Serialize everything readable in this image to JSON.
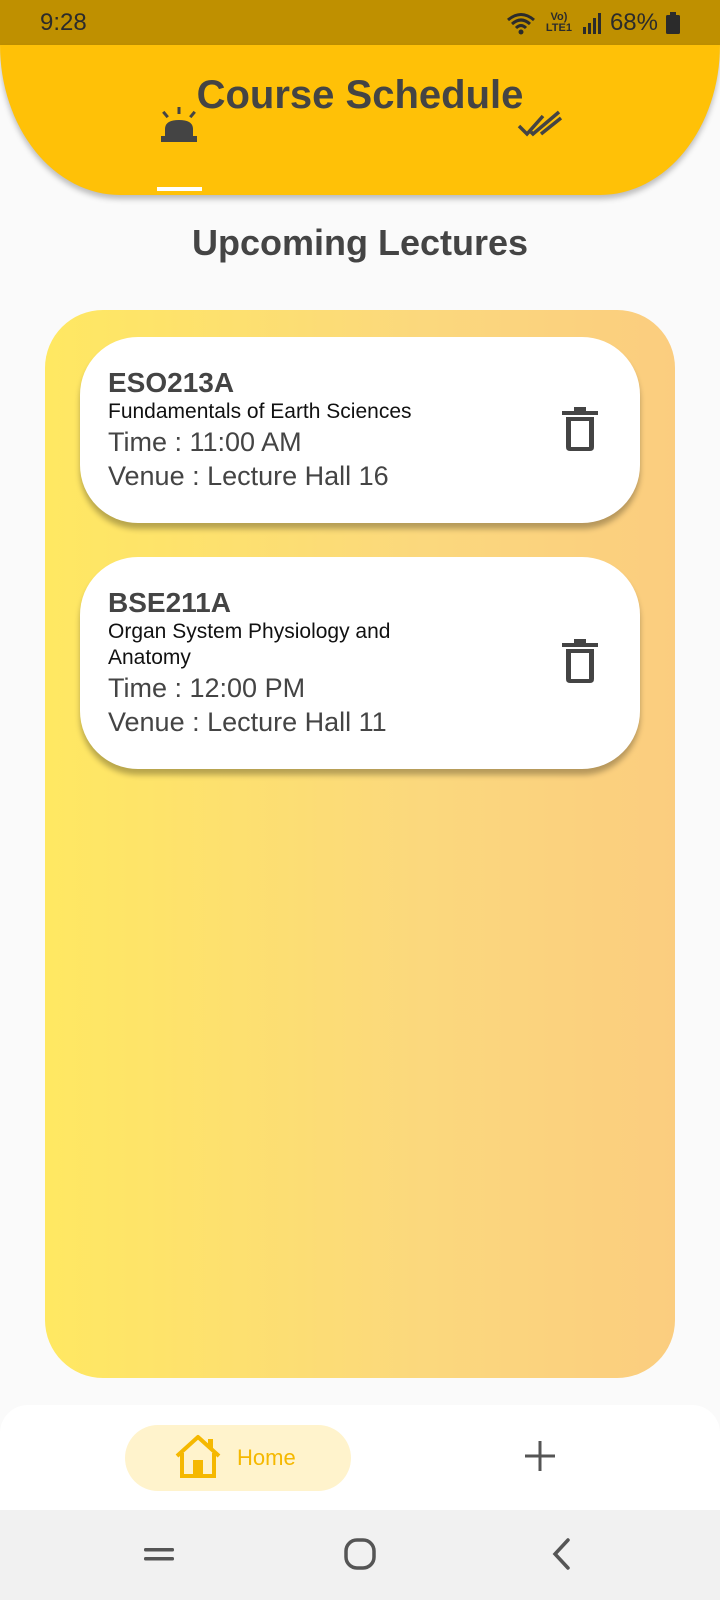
{
  "status_bar": {
    "time": "9:28",
    "network_label": "Vo) LTE1",
    "battery": "68%",
    "icons": [
      "wifi-icon",
      "signal-icon",
      "battery-icon"
    ]
  },
  "header": {
    "title": "Course Schedule",
    "tabs": [
      {
        "icon": "alarm-light-icon",
        "selected": true
      },
      {
        "icon": "double-check-icon",
        "selected": false
      }
    ]
  },
  "section": {
    "title": "Upcoming Lectures"
  },
  "lectures": [
    {
      "code": "ESO213A",
      "name": "Fundamentals of Earth Sciences",
      "time": "Time : 11:00 AM",
      "venue": "Venue : Lecture Hall 16"
    },
    {
      "code": "BSE211A",
      "name": "Organ System Physiology and Anatomy",
      "time": "Time : 12:00 PM",
      "venue": "Venue : Lecture Hall 11"
    }
  ],
  "bottom_nav": {
    "home_label": "Home",
    "home_icon": "home-icon",
    "add_icon": "plus-icon"
  },
  "colors": {
    "accent": "#ffc107",
    "status_bar": "#bf9000",
    "home_label": "#f5b800",
    "home_pill": "#fff3cc",
    "panel_start": "#ffe862",
    "panel_end": "#fbcd7f"
  }
}
